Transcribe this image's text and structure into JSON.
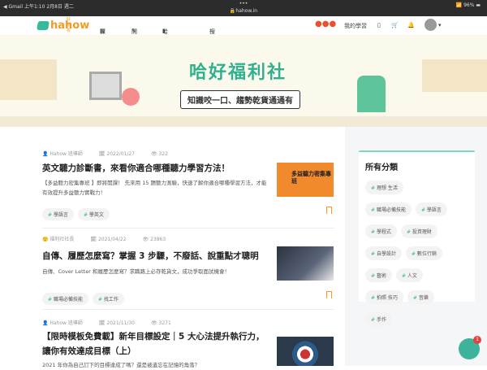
{
  "status_bar": {
    "back_app": "◀ Gmail",
    "time": "上午1:10",
    "date": "2月8日 週二",
    "url": "hahow.in",
    "battery": "96%"
  },
  "nav": {
    "logo": "hahow",
    "logo_sub": "好學校",
    "explore": "探索",
    "teach": "開課",
    "welfare": "哈好福利社",
    "search": "搜尋",
    "my_learning": "我的學習"
  },
  "banner": {
    "title": "哈好福利社",
    "subtitle": "知識咬一口、趨勢乾貨通通有"
  },
  "articles": [
    {
      "author": "Hahow 班導師",
      "date": "2022/01/27",
      "views": "322",
      "title": "英文聽力診斷書，來看你適合哪種聽力學習方法！",
      "desc": "【多益聽力密集專班 】即將開課！ 先來用 15 題聽力測驗，快速了解你適合哪種學習方法，才能有效提升多益聽力實戰力！",
      "tags": [
        "學語言",
        "學英文"
      ],
      "thumb_text": "多益聽力密集專班"
    },
    {
      "author": "福利社社長",
      "date": "2021/04/22",
      "views": "23863",
      "title": "自傳、履歷怎麼寫？掌握 3 步驟，不廢話、說重點才聰明",
      "desc": "自傳、Cover Letter 和履歷怎麼寫？求職路上必存乾貨文，成功爭取面試機會！",
      "tags": [
        "職場必備技能",
        "找工作"
      ]
    },
    {
      "author": "Hahow 班導師",
      "date": "2021/11/30",
      "views": "3271",
      "title": "【限時模板免費載】新年目標設定｜5 大心法提升執行力，讓你有效達成目標（上）",
      "desc": "2021 年你為自己訂下的目標達成了嗎？還是被遺忘在記憶的角落？"
    }
  ],
  "sidebar": {
    "title": "所有分類",
    "categories": [
      "理想 生活",
      "職場必備技能",
      "學語言",
      "學程式",
      "投資理財",
      "自學設計",
      "數位行銷",
      "藝術",
      "人文",
      "拍照 技巧",
      "音樂",
      "手作"
    ]
  },
  "chat": {
    "badge": "1"
  },
  "colors": {
    "brand_green": "#38b89c",
    "brand_orange": "#f59a23"
  }
}
